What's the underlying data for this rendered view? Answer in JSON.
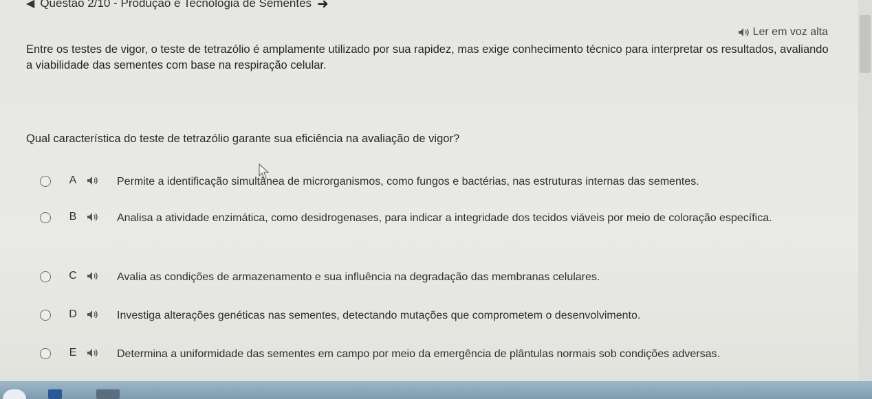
{
  "header": {
    "title": "Questão 2/10 - Produção e Tecnologia de Sementes",
    "back_icon": "arrow-left-icon",
    "next_icon": "arrow-right-icon"
  },
  "read_aloud": {
    "label": "Ler em voz alta",
    "icon": "speaker-icon"
  },
  "statement": "Entre os testes de vigor, o teste de tetrazólio é amplamente utilizado por sua rapidez, mas exige conhecimento técnico para interpretar os resultados, avaliando a viabilidade das sementes com base na respiração celular.",
  "question": "Qual característica do teste de tetrazólio garante sua eficiência na avaliação de vigor?",
  "options": [
    {
      "letter": "A",
      "text": "Permite a identificação simultânea de microrganismos, como fungos e bactérias, nas estruturas internas das sementes."
    },
    {
      "letter": "B",
      "text": "Analisa a atividade enzimática, como desidrogenases, para indicar a integridade dos tecidos viáveis por meio de coloração específica."
    },
    {
      "letter": "C",
      "text": "Avalia as condições de armazenamento e sua influência na degradação das membranas celulares."
    },
    {
      "letter": "D",
      "text": "Investiga alterações genéticas nas sementes, detectando mutações que comprometem o desenvolvimento."
    },
    {
      "letter": "E",
      "text": "Determina a uniformidade das sementes em campo por meio da emergência de plântulas normais sob condições adversas."
    }
  ],
  "colors": {
    "taskbar": "#8aa8ba",
    "text": "#2a2a2a",
    "background": "#e8e8e4"
  }
}
